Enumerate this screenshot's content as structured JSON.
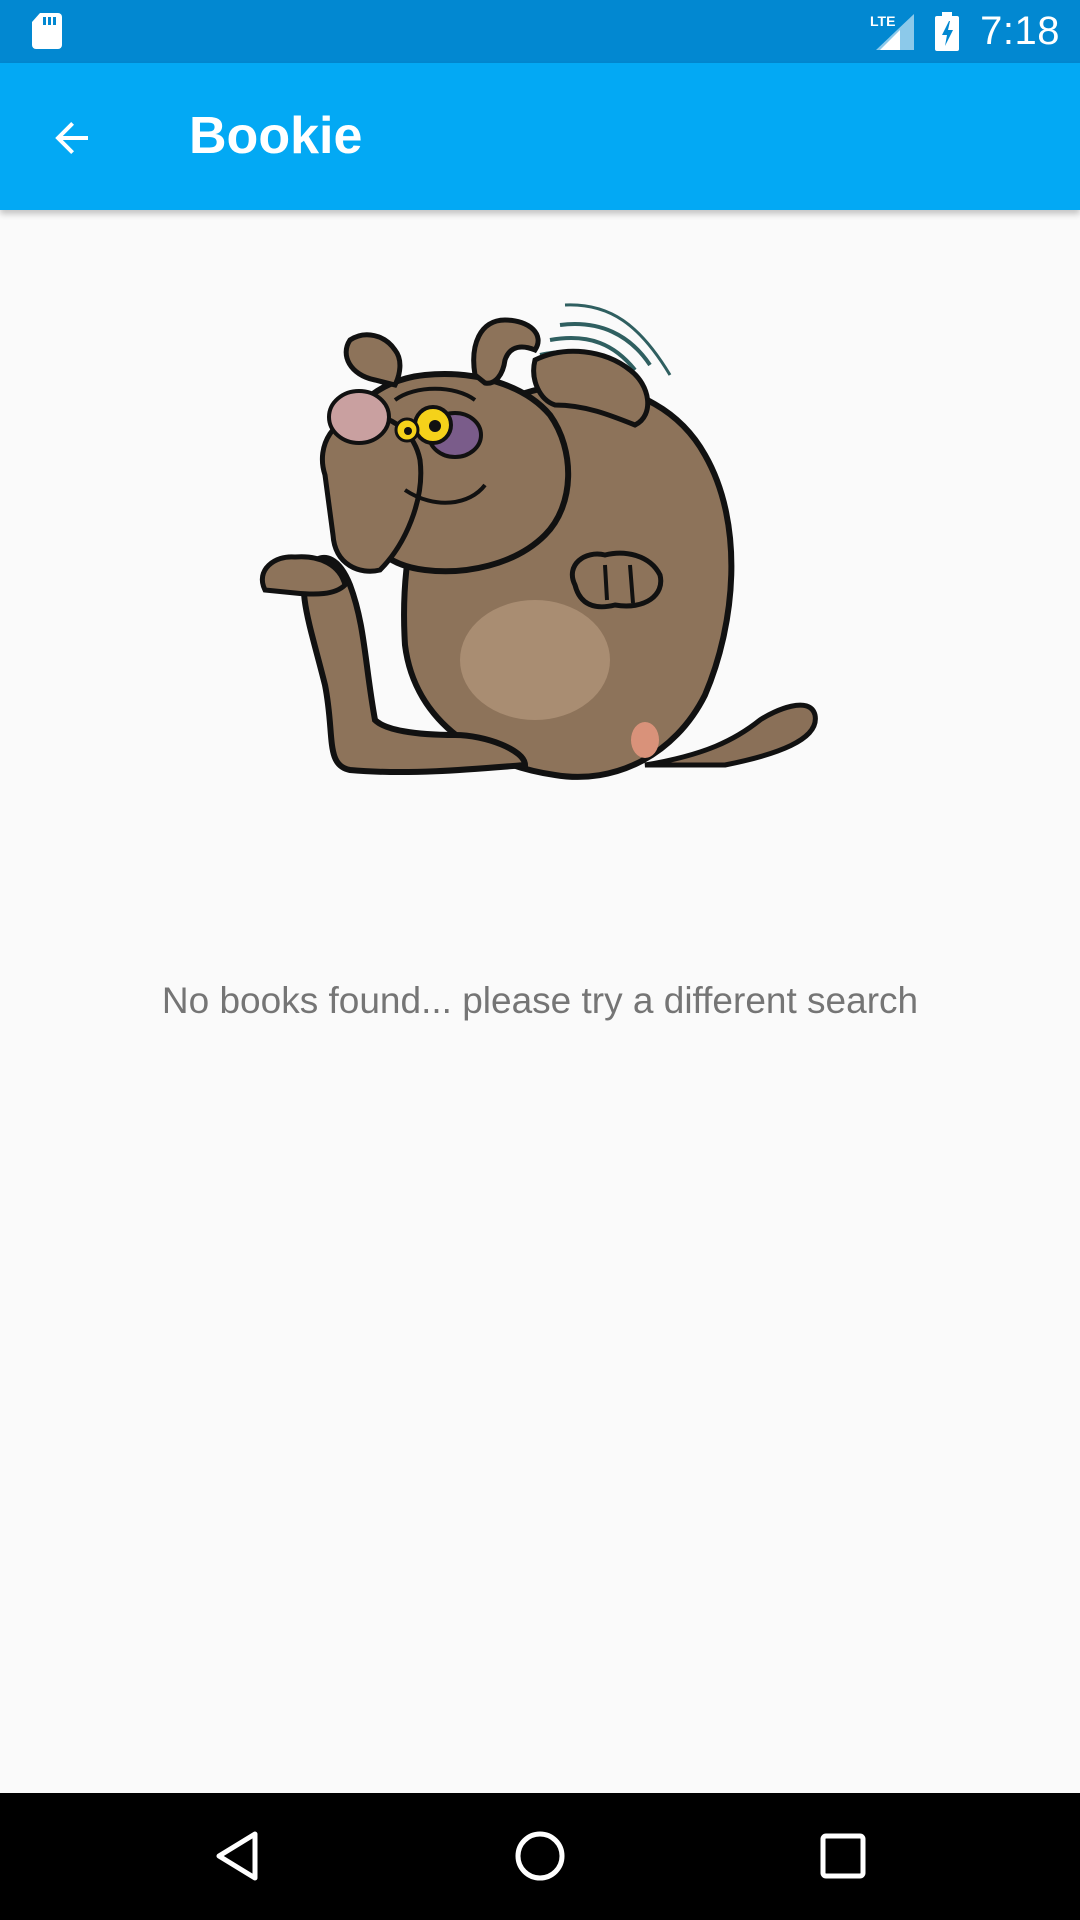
{
  "status_bar": {
    "network_label": "LTE",
    "time": "7:18",
    "icons": [
      "sd-card-icon",
      "lte-signal-icon",
      "battery-charging-icon"
    ]
  },
  "app_bar": {
    "title": "Bookie",
    "back_icon": "arrow-back-icon",
    "color": "#03a9f4",
    "status_color": "#0288d1"
  },
  "empty_state": {
    "illustration": "confused-dog-illustration",
    "message": "No books found... please try a different search"
  },
  "nav_bar": {
    "icons": [
      "nav-back-icon",
      "nav-home-icon",
      "nav-recents-icon"
    ]
  }
}
